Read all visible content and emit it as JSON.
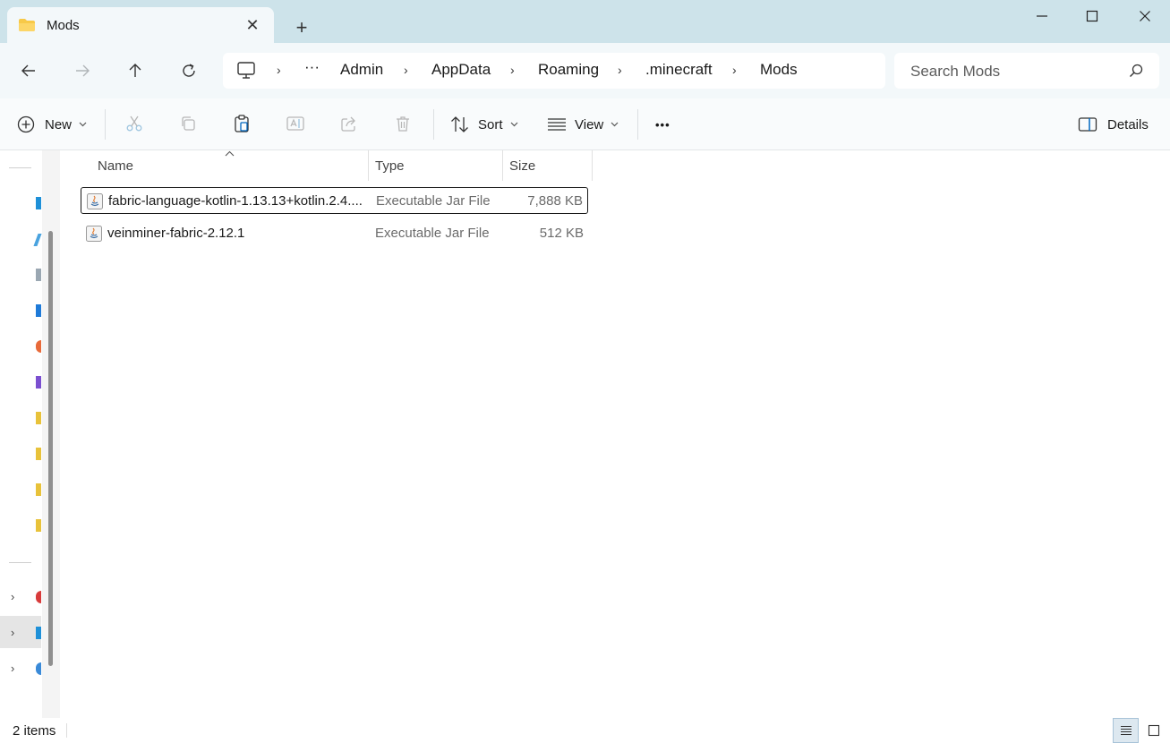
{
  "window": {
    "tab_title": "Mods",
    "close_tab_glyph": "✕",
    "new_tab_glyph": "+"
  },
  "breadcrumb": {
    "overflow": "···",
    "items": [
      "Admin",
      "AppData",
      "Roaming",
      ".minecraft",
      "Mods"
    ],
    "separator": "›"
  },
  "search": {
    "placeholder": "Search Mods"
  },
  "commandbar": {
    "new_label": "New",
    "sort_label": "Sort",
    "view_label": "View",
    "more_label": "•••",
    "details_label": "Details"
  },
  "columns": {
    "name": "Name",
    "type": "Type",
    "size": "Size"
  },
  "files": [
    {
      "name": "fabric-language-kotlin-1.13.13+kotlin.2.4....",
      "type": "Executable Jar File",
      "size": "7,888 KB"
    },
    {
      "name": "veinminer-fabric-2.12.1",
      "type": "Executable Jar File",
      "size": "512 KB"
    }
  ],
  "status": {
    "item_count": "2 items"
  },
  "colors": {
    "titlebar": "#cde3ea",
    "address_row": "#f3f8fa",
    "accent": "#0067c0"
  }
}
